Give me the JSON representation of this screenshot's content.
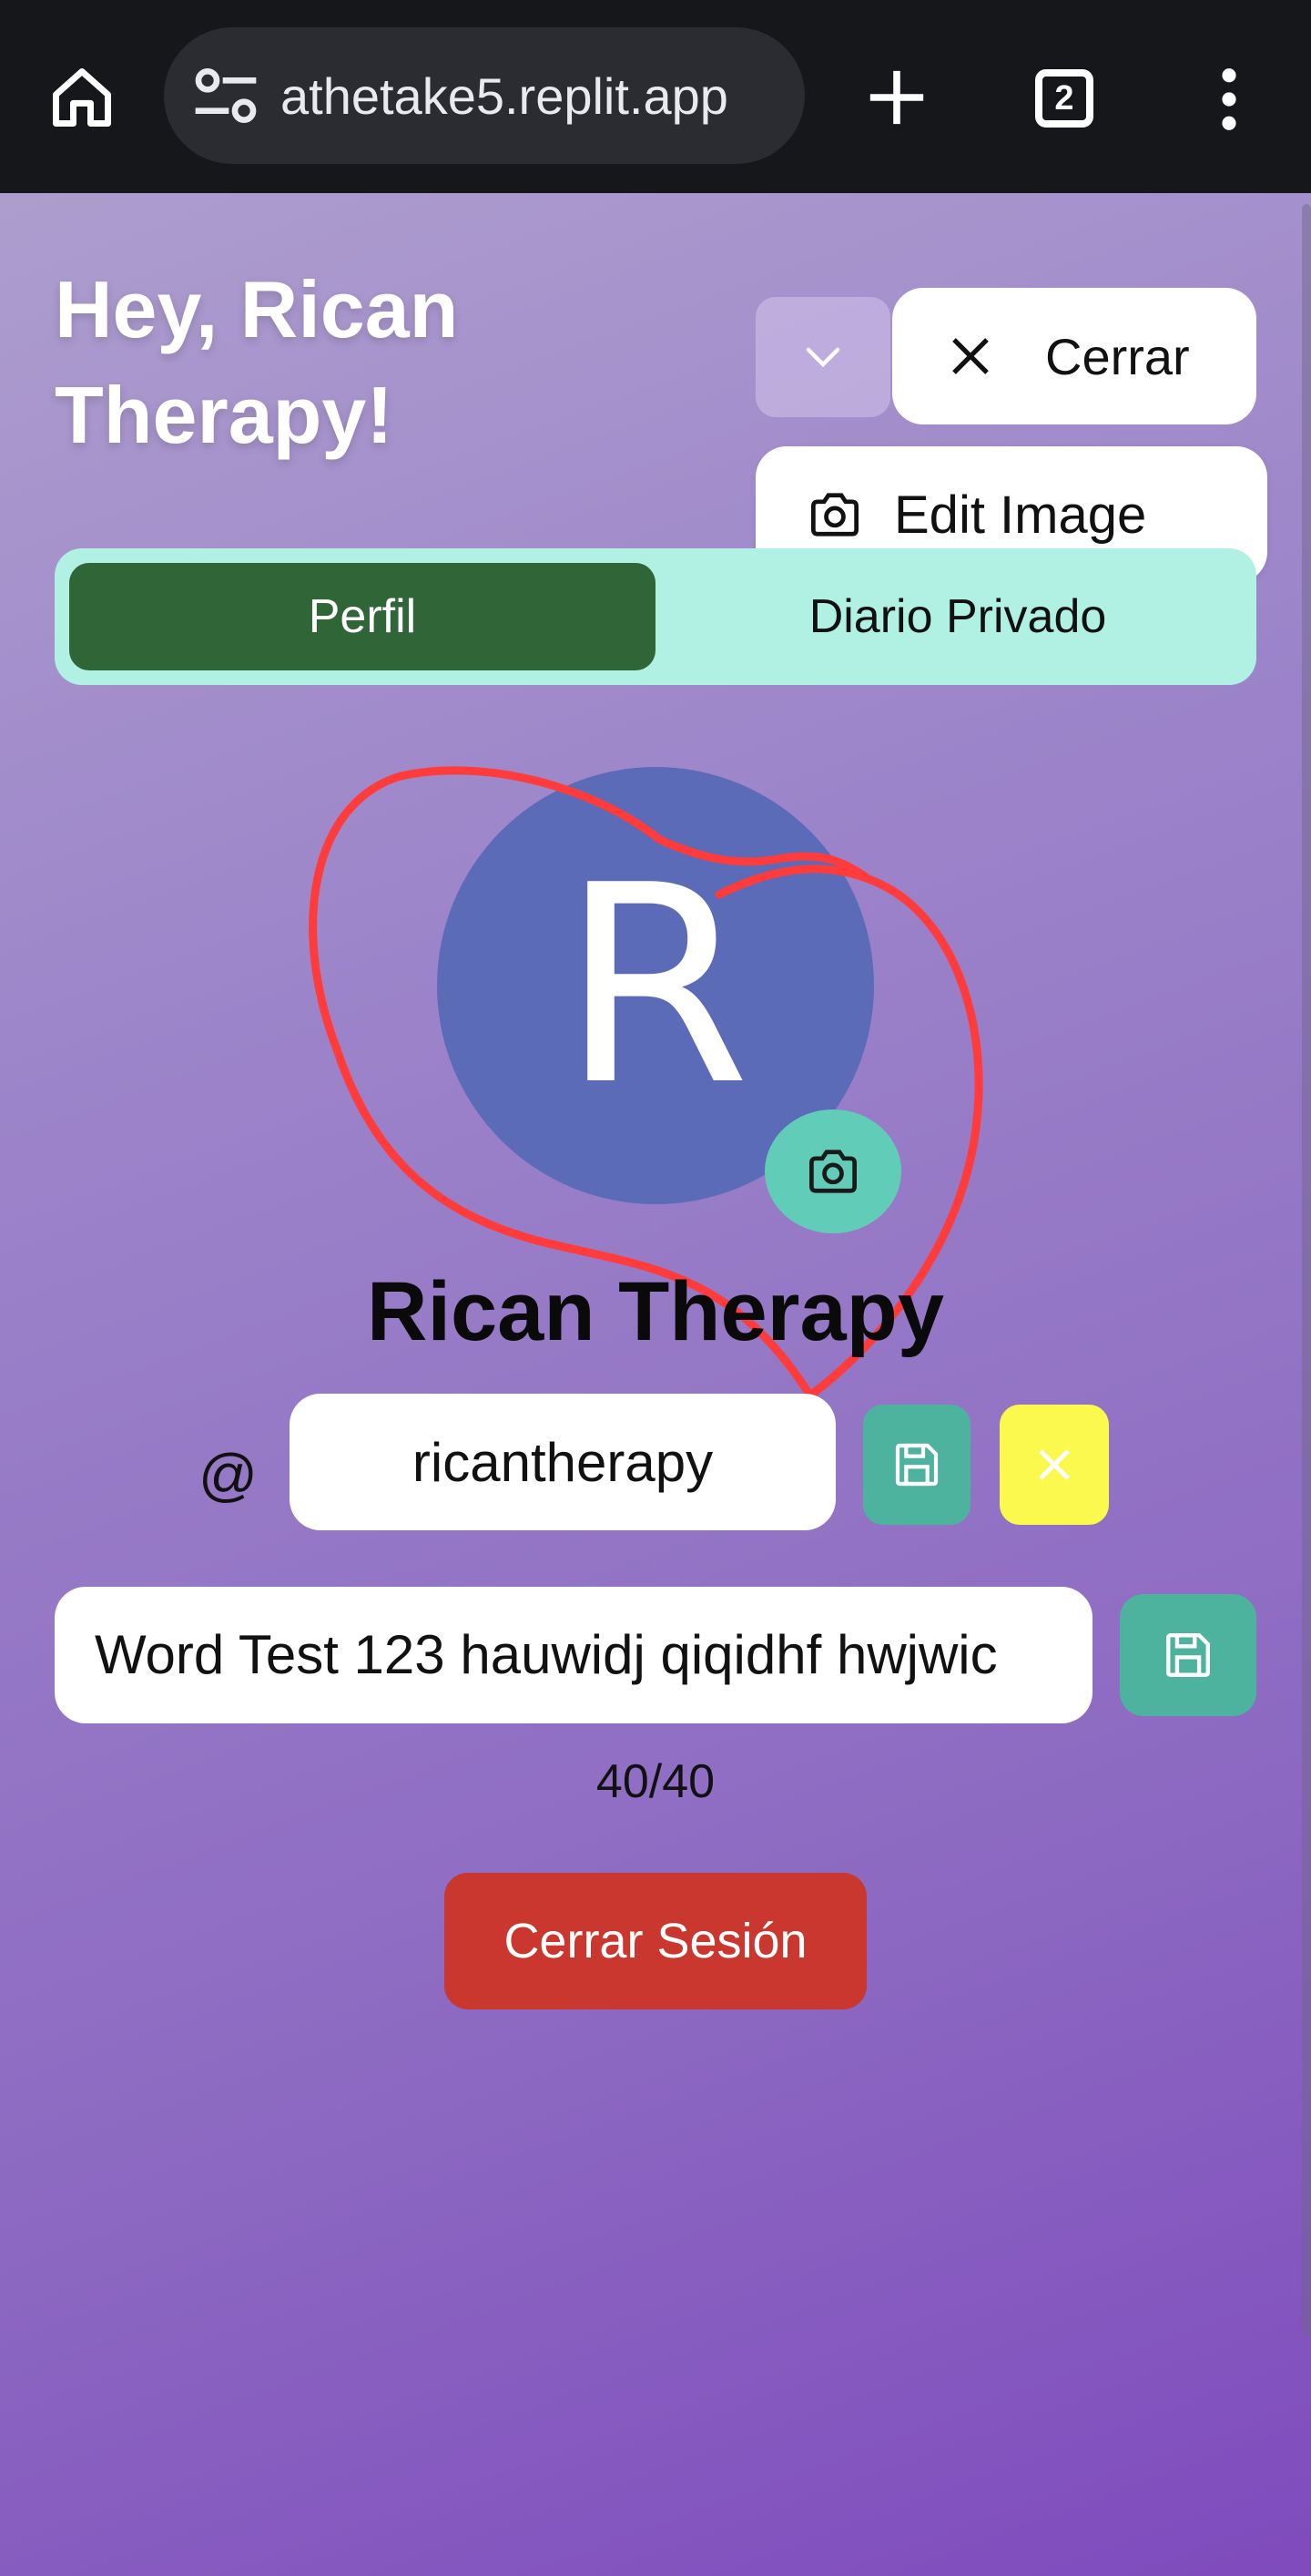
{
  "browser": {
    "url": "athetake5.replit.app",
    "tab_count": "2",
    "icons": {
      "home": "home-icon",
      "site_settings": "tune-icon",
      "new_tab": "plus-icon",
      "tabs": "tab-switcher-icon",
      "menu": "more-vert-icon"
    }
  },
  "header": {
    "greeting": "Hey, Rican Therapy!",
    "close_label": "Cerrar",
    "menu": {
      "edit_image_label": "Edit Image"
    }
  },
  "tabs": [
    {
      "label": "Perfil",
      "active": true
    },
    {
      "label": "Diario Privado",
      "active": false
    }
  ],
  "profile": {
    "avatar_initial": "R",
    "display_name": "Rican Therapy",
    "at_symbol": "@",
    "username": "ricantherapy",
    "bio": "Word Test 123 hauwidj qiqidhf hwjwic",
    "bio_counter": "40/40",
    "logout_label": "Cerrar Sesión"
  },
  "colors": {
    "tab_active": "#2f6537",
    "tab_bar": "#b1f1e3",
    "save": "#4eb39e",
    "cancel": "#fbf94e",
    "logout": "#c9372f",
    "avatar": "#5c6bb8",
    "annotation": "#ff3b3b"
  }
}
